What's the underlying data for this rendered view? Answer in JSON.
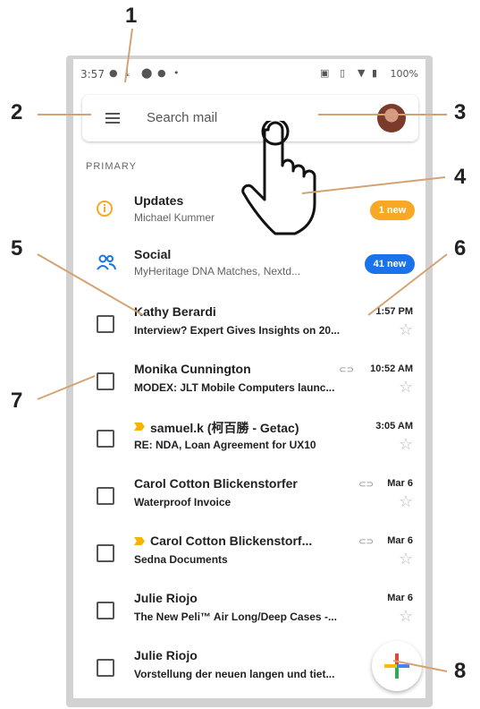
{
  "status_bar": {
    "time": "3:57",
    "battery": "100%"
  },
  "search": {
    "placeholder": "Search mail"
  },
  "section_label": "PRIMARY",
  "categories": [
    {
      "name": "Updates",
      "sub": "Michael Kummer",
      "badge": "1 new",
      "badge_color": "#f9a825",
      "icon": "info-icon"
    },
    {
      "name": "Social",
      "sub": "MyHeritage DNA Matches, Nextd...",
      "badge": "41 new",
      "badge_color": "#1a73e8",
      "icon": "people-icon"
    }
  ],
  "emails": [
    {
      "sender": "Kathy Berardi",
      "subject": "Interview? Expert Gives Insights on 20...",
      "time": "1:57 PM",
      "attachment": false,
      "important": false
    },
    {
      "sender": "Monika Cunnington",
      "subject": "MODEX: JLT Mobile Computers launc...",
      "time": "10:52 AM",
      "attachment": true,
      "important": false
    },
    {
      "sender": "samuel.k (柯百勝 - Getac)",
      "subject": "RE: NDA, Loan Agreement for UX10",
      "time": "3:05 AM",
      "attachment": false,
      "important": true
    },
    {
      "sender": "Carol Cotton Blickenstorfer",
      "subject": "Waterproof Invoice",
      "time": "Mar 6",
      "attachment": true,
      "important": false
    },
    {
      "sender": "Carol Cotton Blickenstorf...",
      "subject": "Sedna Documents",
      "time": "Mar 6",
      "attachment": true,
      "important": true
    },
    {
      "sender": "Julie Riojo",
      "subject": "The New Peli™ Air Long/Deep Cases -...",
      "time": "Mar 6",
      "attachment": false,
      "important": false
    },
    {
      "sender": "Julie Riojo",
      "subject": "Vorstellung der neuen langen und tiet...",
      "time": "",
      "attachment": false,
      "important": false
    }
  ],
  "callouts": [
    "1",
    "2",
    "3",
    "4",
    "5",
    "6",
    "7",
    "8"
  ]
}
